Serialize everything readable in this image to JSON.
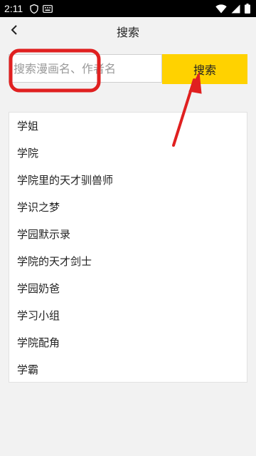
{
  "status_bar": {
    "time": "2:11",
    "icons": [
      "shield-icon",
      "keyboard-icon",
      "wifi-icon",
      "signal-icon",
      "battery-icon"
    ]
  },
  "header": {
    "back_icon": "chevron-left-icon",
    "title": "搜索"
  },
  "search": {
    "placeholder": "搜索漫画名、作者名",
    "value": "",
    "button_label": "搜索"
  },
  "suggestions": [
    "学姐",
    "学院",
    "学院里的天才驯兽师",
    "学识之梦",
    "学园默示录",
    "学院的天才剑士",
    "学园奶爸",
    "学习小组",
    "学院配角",
    "学霸"
  ],
  "colors": {
    "accent": "#ffd200",
    "annotation": "#e02020",
    "background": "#f2f2f2"
  }
}
